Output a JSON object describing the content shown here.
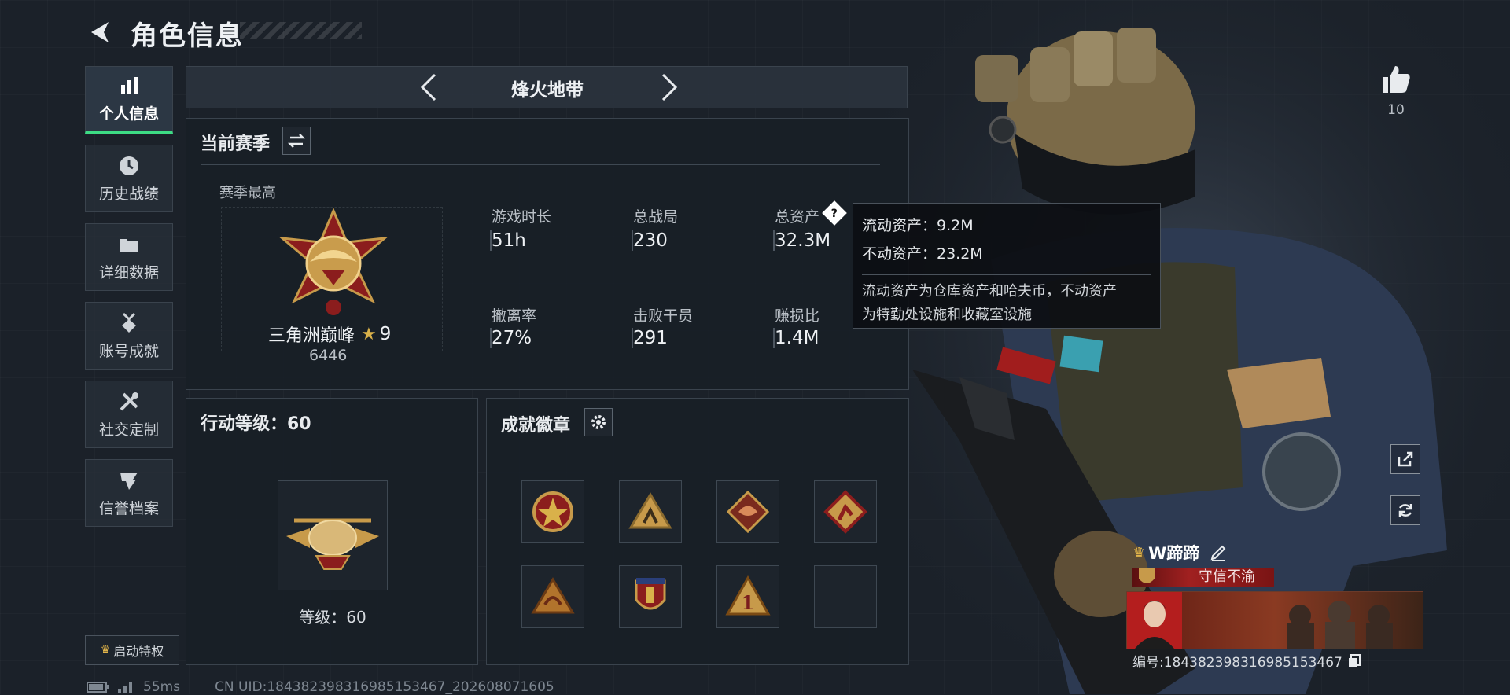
{
  "header": {
    "title": "角色信息",
    "back_icon": "back-arrow-icon"
  },
  "sidebar": {
    "items": [
      {
        "label": "个人信息",
        "icon": "bar-chart-icon",
        "active": true
      },
      {
        "label": "历史战绩",
        "icon": "clock-icon"
      },
      {
        "label": "详细数据",
        "icon": "folder-icon"
      },
      {
        "label": "账号成就",
        "icon": "medal-icon"
      },
      {
        "label": "社交定制",
        "icon": "tools-icon"
      },
      {
        "label": "信誉档案",
        "icon": "shield-icon"
      }
    ],
    "privilege_button": "启动特权"
  },
  "mode": {
    "name": "烽火地带"
  },
  "season": {
    "title": "当前赛季",
    "best_label": "赛季最高",
    "rank_name": "三角洲巅峰",
    "rank_stars": "9",
    "rank_score": "6446",
    "stats": [
      {
        "label": "游戏时长",
        "value": "51h"
      },
      {
        "label": "总战局",
        "value": "230"
      },
      {
        "label": "总资产",
        "value": "32.3M"
      },
      {
        "label": "撤离率",
        "value": "27%"
      },
      {
        "label": "击败干员",
        "value": "291"
      },
      {
        "label": "赚损比",
        "value": "1.4M"
      }
    ]
  },
  "tooltip": {
    "liquid": "流动资产：9.2M",
    "fixed": "不动资产：23.2M",
    "desc_line1": "流动资产为仓库资产和哈夫币，不动资产",
    "desc_line2": "为特勤处设施和收藏室设施"
  },
  "action_level": {
    "title": "行动等级：60",
    "level_text": "等级：60"
  },
  "achievements": {
    "title": "成就徽章",
    "badges": [
      "star-medal-icon",
      "climber-badge-icon",
      "dragon-badge-icon",
      "runner-badge-icon",
      "dragon-triangle-icon",
      "shield-eagle-icon",
      "number-one-icon",
      "empty-slot"
    ]
  },
  "profile": {
    "likes": "10",
    "player_name": "W蹄蹄",
    "motto": "守信不渝",
    "id_text": "编号:18438239831698515346​7",
    "id_display": "编号:184382398316985153467"
  },
  "footer": {
    "ping": "55ms",
    "uid": "CN UID:184382398316985153467_202608071605"
  },
  "colors": {
    "accent_green": "#3ddc84",
    "motto_red": "#8a1c1c",
    "background": "#1b2129"
  }
}
